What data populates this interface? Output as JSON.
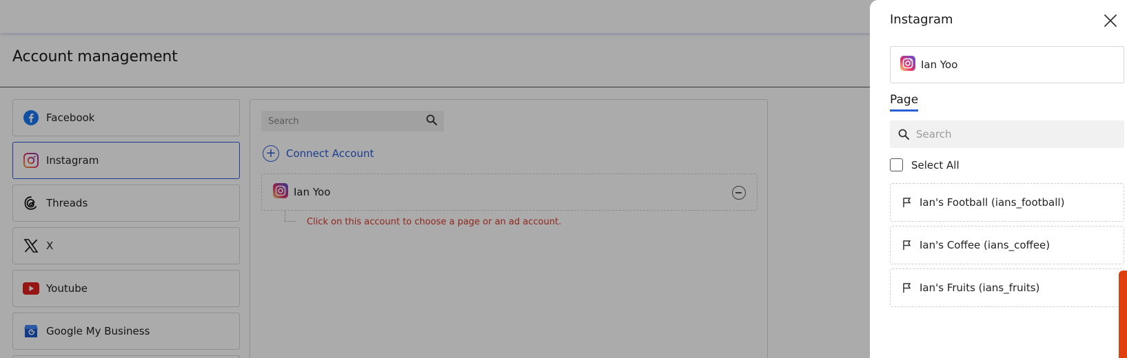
{
  "app": {
    "page_title": "Account management"
  },
  "platforms": [
    {
      "label": "Facebook",
      "icon": "facebook-icon"
    },
    {
      "label": "Instagram",
      "icon": "instagram-icon",
      "active": true
    },
    {
      "label": "Threads",
      "icon": "threads-icon"
    },
    {
      "label": "X",
      "icon": "x-icon"
    },
    {
      "label": "Youtube",
      "icon": "youtube-icon"
    },
    {
      "label": "Google My Business",
      "icon": "google-my-business-icon"
    }
  ],
  "main": {
    "search_placeholder": "Search",
    "connect_label": "Connect Account",
    "account_name": "Ian Yoo",
    "hint": "Click on this account to choose a page or an ad account."
  },
  "drawer": {
    "title": "Instagram",
    "account_name": "Ian Yoo",
    "tab_label": "Page",
    "search_placeholder": "Search",
    "select_all_label": "Select All",
    "pages": [
      "Ian's Football (ians_football)",
      "Ian's Coffee (ians_coffee)",
      "Ian's Fruits (ians_fruits)"
    ]
  },
  "colors": {
    "accent": "#2a5cd6",
    "error": "#d83a2a",
    "side_tab": "#e0400e",
    "youtube": "#e02020",
    "facebook": "#1877f2"
  }
}
